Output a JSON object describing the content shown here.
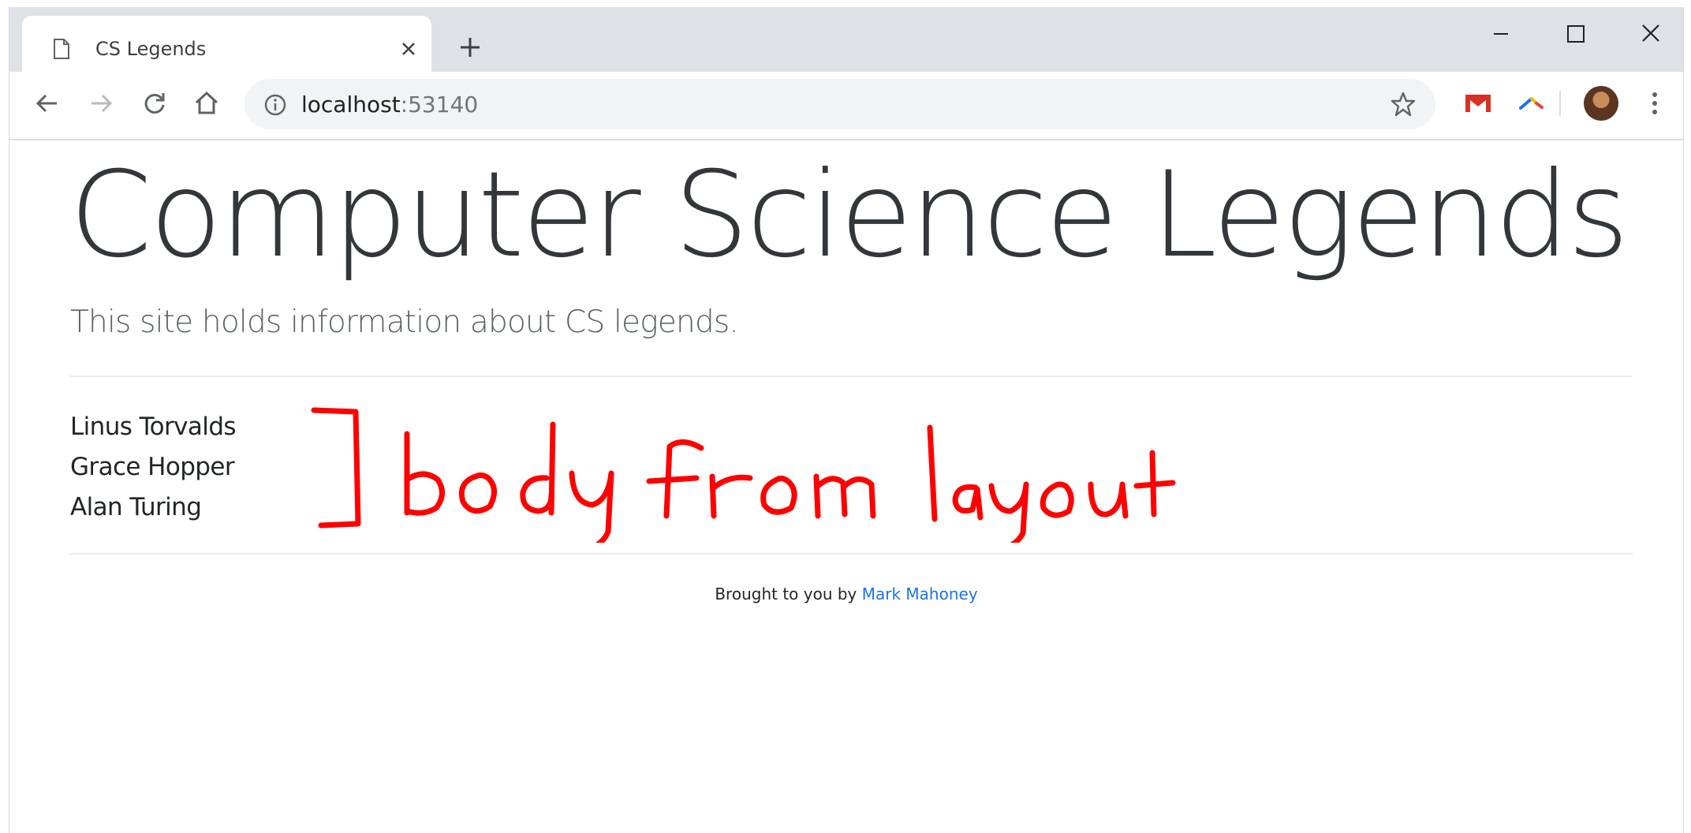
{
  "browser": {
    "tab_title": "CS Legends",
    "url_host": "localhost",
    "url_port": ":53140"
  },
  "page": {
    "title": "Computer Science Legends",
    "lead": "This site holds information about CS legends.",
    "legends": [
      "Linus Torvalds",
      "Grace Hopper",
      "Alan Turing"
    ],
    "annotation": "body from layout",
    "footer_prefix": "Brought to you by",
    "footer_link": "Mark Mahoney"
  },
  "colors": {
    "annotation": "#ff0000",
    "link": "#1a73e8"
  },
  "icons": [
    "page-icon",
    "close-icon",
    "plus-icon",
    "minimize-icon",
    "maximize-icon",
    "window-close-icon",
    "back-arrow-icon",
    "forward-arrow-icon",
    "reload-icon",
    "home-icon",
    "info-icon",
    "star-icon",
    "gmail-icon",
    "extension-icon",
    "menu-dots-icon"
  ]
}
